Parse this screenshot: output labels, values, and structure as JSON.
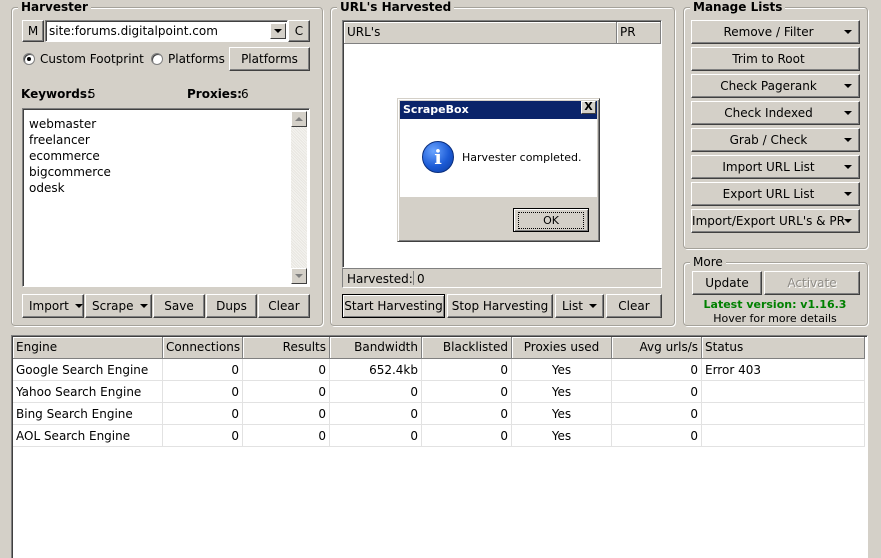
{
  "harvester": {
    "title": "Harvester",
    "m_button": "M",
    "footprint_value": "site:forums.digitalpoint.com",
    "c_button": "C",
    "radio_custom": "Custom Footprint",
    "radio_platforms": "Platforms",
    "platforms_button": "Platforms",
    "keywords_label": "Keywords:",
    "keywords_count": "5",
    "proxies_label": "Proxies:",
    "proxies_count": "6",
    "keywords": [
      "webmaster",
      "freelancer",
      "ecommerce",
      "bigcommerce",
      "odesk"
    ],
    "buttons": {
      "import": "Import",
      "scrape": "Scrape",
      "save": "Save",
      "dups": "Dups",
      "clear": "Clear"
    }
  },
  "urls": {
    "title": "URL's Harvested",
    "col_urls": "URL's",
    "col_pr": "PR",
    "harvested_label": "Harvested:",
    "harvested_count": "0",
    "buttons": {
      "start": "Start Harvesting",
      "stop": "Stop Harvesting",
      "list": "List",
      "clear": "Clear"
    }
  },
  "manage": {
    "title": "Manage Lists",
    "items": [
      {
        "label": "Remove / Filter",
        "dropdown": true
      },
      {
        "label": "Trim to Root",
        "dropdown": false
      },
      {
        "label": "Check Pagerank",
        "dropdown": true
      },
      {
        "label": "Check Indexed",
        "dropdown": true
      },
      {
        "label": "Grab / Check",
        "dropdown": true
      },
      {
        "label": "Import URL List",
        "dropdown": true
      },
      {
        "label": "Export URL List",
        "dropdown": true
      },
      {
        "label": "Import/Export URL's & PR",
        "dropdown": true
      }
    ]
  },
  "more": {
    "title": "More",
    "update": "Update",
    "activate": "Activate",
    "version": "Latest version: v1.16.3",
    "hover": "Hover for more details",
    "version_color": "#008000"
  },
  "engines": {
    "columns": [
      "Engine",
      "Connections",
      "Results",
      "Bandwidth",
      "Blacklisted",
      "Proxies used",
      "Avg urls/s",
      "Status"
    ],
    "rows": [
      [
        "Google Search Engine",
        "0",
        "0",
        "652.4kb",
        "0",
        "Yes",
        "0",
        "Error 403"
      ],
      [
        "Yahoo Search Engine",
        "0",
        "0",
        "0",
        "0",
        "Yes",
        "0",
        ""
      ],
      [
        "Bing Search Engine",
        "0",
        "0",
        "0",
        "0",
        "Yes",
        "0",
        ""
      ],
      [
        "AOL Search Engine",
        "0",
        "0",
        "0",
        "0",
        "Yes",
        "0",
        ""
      ]
    ]
  },
  "dialog": {
    "title": "ScrapeBox",
    "close": "X",
    "message": "Harvester completed.",
    "ok": "OK",
    "icon": "info-icon"
  }
}
